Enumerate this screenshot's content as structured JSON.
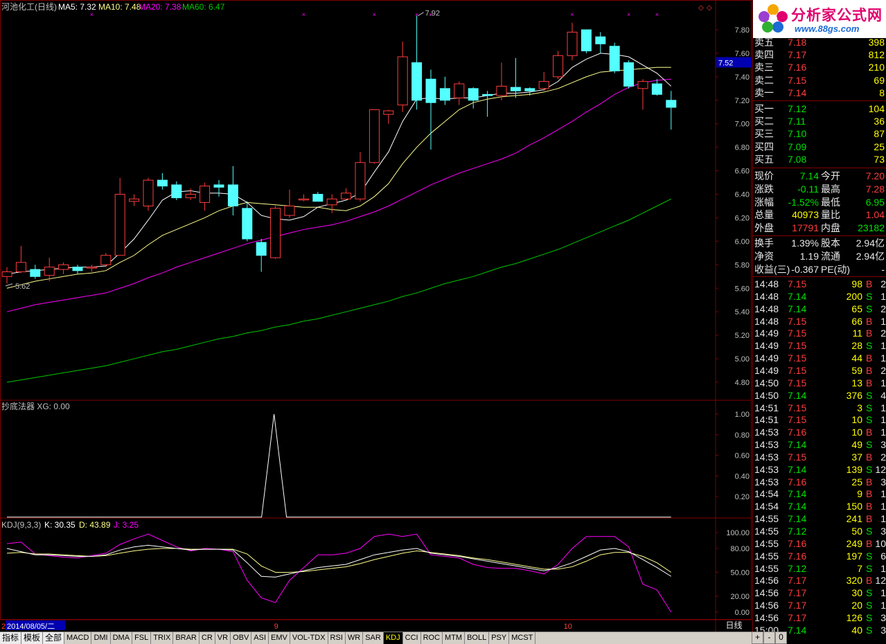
{
  "header": {
    "name": "河池化工(日线)",
    "ma5": "MA5: 7.32",
    "ma10": "MA10: 7.48",
    "ma20": "MA20: 7.38",
    "ma60": "MA60: 6.47",
    "high_label": "7.92",
    "low_label": "5.62",
    "current_price_tag": "7.52"
  },
  "price_axis": [
    "7.80",
    "7.60",
    "7.40",
    "7.20",
    "7.00",
    "6.80",
    "6.60",
    "6.40",
    "6.20",
    "6.00",
    "5.80",
    "5.60",
    "5.40",
    "5.20",
    "5.00",
    "4.80"
  ],
  "xg_pane": {
    "title": "抄底法器 XG: 0.00",
    "axis": [
      "1.00",
      "0.80",
      "0.60",
      "0.40",
      "0.20"
    ]
  },
  "kdj_pane": {
    "title_name": "KDJ(9,3,3)",
    "k": "K: 30.35",
    "d": "D: 43.89",
    "j": "J: 3.25",
    "axis": [
      "100.00",
      "80.00",
      "50.00",
      "20.00",
      "0.00"
    ]
  },
  "date_axis": {
    "left_mark": "2",
    "date_label": "2014/08/05/二",
    "month9": "9",
    "month10": "10",
    "period": "日线"
  },
  "colors": {
    "up": "#ff3c3c",
    "down": "#54ffff",
    "ma5": "#ffffff",
    "ma10": "#ffff8c",
    "ma20": "#ff00ff",
    "ma60": "#00c800",
    "border": "#800000"
  },
  "logo": {
    "title": "分析家公式网",
    "url": "www.88gs.com"
  },
  "asks": [
    {
      "label": "卖五",
      "price": "7.18",
      "vol": "398"
    },
    {
      "label": "卖四",
      "price": "7.17",
      "vol": "812"
    },
    {
      "label": "卖三",
      "price": "7.16",
      "vol": "210"
    },
    {
      "label": "卖二",
      "price": "7.15",
      "vol": "69"
    },
    {
      "label": "卖一",
      "price": "7.14",
      "vol": "8"
    }
  ],
  "bids": [
    {
      "label": "买一",
      "price": "7.12",
      "vol": "104"
    },
    {
      "label": "买二",
      "price": "7.11",
      "vol": "36"
    },
    {
      "label": "买三",
      "price": "7.10",
      "vol": "87"
    },
    {
      "label": "买四",
      "price": "7.09",
      "vol": "25"
    },
    {
      "label": "买五",
      "price": "7.08",
      "vol": "73"
    }
  ],
  "stats": [
    {
      "l1": "现价",
      "v1": "7.14",
      "c1": "grn",
      "l2": "今开",
      "v2": "7.20",
      "c2": "red"
    },
    {
      "l1": "涨跌",
      "v1": "-0.11",
      "c1": "grn",
      "l2": "最高",
      "v2": "7.28",
      "c2": "red"
    },
    {
      "l1": "涨幅",
      "v1": "-1.52%",
      "c1": "grn",
      "l2": "最低",
      "v2": "6.95",
      "c2": "grn"
    },
    {
      "l1": "总量",
      "v1": "40973",
      "c1": "yel",
      "l2": "量比",
      "v2": "1.04",
      "c2": "red"
    },
    {
      "l1": "外盘",
      "v1": "17791",
      "c1": "red",
      "l2": "内盘",
      "v2": "23182",
      "c2": "grn"
    }
  ],
  "stats2": [
    {
      "l1": "换手",
      "v1": "1.39%",
      "l2": "股本",
      "v2": "2.94亿"
    },
    {
      "l1": "净资",
      "v1": "1.19",
      "l2": "流通",
      "v2": "2.94亿"
    },
    {
      "l1": "收益(三)",
      "v1": "-0.367",
      "l2": "PE(动)",
      "v2": "-"
    }
  ],
  "ticks": [
    [
      "14:48",
      "7.15",
      "98",
      "B",
      "2"
    ],
    [
      "14:48",
      "7.14",
      "200",
      "S",
      "1"
    ],
    [
      "14:48",
      "7.14",
      "65",
      "S",
      "2"
    ],
    [
      "14:48",
      "7.15",
      "66",
      "B",
      "1"
    ],
    [
      "14:49",
      "7.15",
      "11",
      "B",
      "2"
    ],
    [
      "14:49",
      "7.15",
      "28",
      "S",
      "1"
    ],
    [
      "14:49",
      "7.15",
      "44",
      "B",
      "1"
    ],
    [
      "14:49",
      "7.15",
      "59",
      "B",
      "2"
    ],
    [
      "14:50",
      "7.15",
      "13",
      "B",
      "1"
    ],
    [
      "14:50",
      "7.14",
      "376",
      "S",
      "4"
    ],
    [
      "14:51",
      "7.15",
      "3",
      "S",
      "1"
    ],
    [
      "14:51",
      "7.15",
      "10",
      "S",
      "1"
    ],
    [
      "14:53",
      "7.16",
      "10",
      "B",
      "1"
    ],
    [
      "14:53",
      "7.14",
      "49",
      "S",
      "3"
    ],
    [
      "14:53",
      "7.15",
      "37",
      "B",
      "2"
    ],
    [
      "14:53",
      "7.14",
      "139",
      "S",
      "12"
    ],
    [
      "14:53",
      "7.16",
      "25",
      "B",
      "3"
    ],
    [
      "14:54",
      "7.14",
      "9",
      "B",
      "1"
    ],
    [
      "14:54",
      "7.14",
      "150",
      "B",
      "1"
    ],
    [
      "14:55",
      "7.14",
      "241",
      "B",
      "1"
    ],
    [
      "14:55",
      "7.12",
      "50",
      "S",
      "3"
    ],
    [
      "14:55",
      "7.16",
      "249",
      "B",
      "10"
    ],
    [
      "14:55",
      "7.16",
      "197",
      "S",
      "6"
    ],
    [
      "14:55",
      "7.12",
      "7",
      "S",
      "1"
    ],
    [
      "14:56",
      "7.17",
      "320",
      "B",
      "12"
    ],
    [
      "14:56",
      "7.17",
      "30",
      "S",
      "1"
    ],
    [
      "14:56",
      "7.17",
      "20",
      "S",
      "1"
    ],
    [
      "14:56",
      "7.17",
      "126",
      "S",
      "3"
    ],
    [
      "15:00",
      "7.14",
      "40",
      "S",
      "3"
    ]
  ],
  "tabs": [
    "指标",
    "模板",
    "全部",
    "MACD",
    "DMI",
    "DMA",
    "FSL",
    "TRIX",
    "BRAR",
    "CR",
    "VR",
    "OBV",
    "ASI",
    "EMV",
    "VOL-TDX",
    "RSI",
    "WR",
    "SAR",
    "KDJ",
    "CCI",
    "ROC",
    "MTM",
    "BOLL",
    "PSY",
    "MCST"
  ],
  "selected_tab": "KDJ",
  "nav": [
    "+",
    "-",
    "0"
  ],
  "chart_data": {
    "type": "candlestick",
    "candles": [
      [
        5.7,
        5.74,
        5.64,
        5.78
      ],
      [
        5.74,
        5.82,
        5.73,
        5.96
      ],
      [
        5.76,
        5.7,
        5.68,
        5.8
      ],
      [
        5.71,
        5.78,
        5.66,
        5.86
      ],
      [
        5.76,
        5.8,
        5.72,
        5.82
      ],
      [
        5.78,
        5.75,
        5.72,
        5.8
      ],
      [
        5.78,
        5.78,
        5.74,
        5.8
      ],
      [
        5.8,
        5.88,
        5.78,
        5.9
      ],
      [
        5.88,
        6.4,
        5.88,
        6.54
      ],
      [
        6.34,
        6.36,
        6.3,
        6.4
      ],
      [
        6.3,
        6.52,
        6.26,
        6.54
      ],
      [
        6.52,
        6.47,
        6.44,
        6.58
      ],
      [
        6.48,
        6.37,
        6.35,
        6.51
      ],
      [
        6.37,
        6.4,
        6.35,
        6.45
      ],
      [
        6.33,
        6.47,
        6.26,
        6.5
      ],
      [
        6.48,
        6.46,
        6.38,
        6.52
      ],
      [
        6.48,
        6.3,
        6.22,
        6.64
      ],
      [
        6.28,
        6.02,
        6.0,
        6.34
      ],
      [
        5.99,
        5.88,
        5.74,
        6.02
      ],
      [
        5.86,
        6.28,
        5.85,
        6.3
      ],
      [
        6.22,
        6.3,
        6.2,
        6.44
      ],
      [
        6.36,
        6.36,
        6.34,
        6.4
      ],
      [
        6.4,
        6.34,
        6.34,
        6.42
      ],
      [
        6.31,
        6.36,
        6.24,
        6.4
      ],
      [
        6.36,
        6.41,
        6.36,
        6.45
      ],
      [
        6.36,
        6.67,
        6.34,
        6.76
      ],
      [
        6.67,
        7.12,
        6.66,
        7.12
      ],
      [
        7.08,
        7.11,
        7.0,
        7.12
      ],
      [
        7.16,
        7.57,
        7.1,
        7.7
      ],
      [
        7.52,
        7.2,
        7.12,
        7.92
      ],
      [
        7.38,
        7.18,
        6.78,
        7.46
      ],
      [
        7.3,
        7.2,
        7.16,
        7.4
      ],
      [
        7.22,
        7.34,
        7.16,
        7.36
      ],
      [
        7.3,
        7.2,
        7.13,
        7.31
      ],
      [
        7.25,
        7.24,
        7.06,
        7.28
      ],
      [
        7.24,
        7.32,
        7.2,
        7.52
      ],
      [
        7.31,
        7.28,
        7.22,
        7.56
      ],
      [
        7.3,
        7.28,
        7.24,
        7.31
      ],
      [
        7.3,
        7.36,
        7.28,
        7.44
      ],
      [
        7.4,
        7.58,
        7.38,
        7.62
      ],
      [
        7.58,
        7.78,
        7.54,
        7.86
      ],
      [
        7.8,
        7.62,
        7.6,
        7.8
      ],
      [
        7.74,
        7.68,
        7.6,
        7.78
      ],
      [
        7.66,
        7.45,
        7.43,
        7.69
      ],
      [
        7.52,
        7.32,
        7.3,
        7.54
      ],
      [
        7.3,
        7.36,
        7.12,
        7.38
      ],
      [
        7.34,
        7.25,
        7.24,
        7.38
      ],
      [
        7.2,
        7.14,
        6.95,
        7.28
      ]
    ],
    "ma5": [
      5.72,
      5.74,
      5.75,
      5.76,
      5.77,
      5.78,
      5.78,
      5.79,
      5.9,
      6.02,
      6.18,
      6.35,
      6.42,
      6.43,
      6.41,
      6.41,
      6.4,
      6.33,
      6.22,
      6.19,
      6.18,
      6.21,
      6.29,
      6.32,
      6.35,
      6.41,
      6.59,
      6.76,
      7.02,
      7.21,
      7.22,
      7.21,
      7.22,
      7.22,
      7.24,
      7.26,
      7.26,
      7.27,
      7.29,
      7.36,
      7.48,
      7.55,
      7.6,
      7.59,
      7.57,
      7.5,
      7.43,
      7.32
    ],
    "ma10": [
      5.6,
      5.63,
      5.66,
      5.68,
      5.7,
      5.72,
      5.73,
      5.75,
      5.82,
      5.88,
      5.97,
      6.05,
      6.1,
      6.15,
      6.2,
      6.26,
      6.3,
      6.33,
      6.32,
      6.31,
      6.3,
      6.29,
      6.29,
      6.27,
      6.26,
      6.3,
      6.38,
      6.49,
      6.66,
      6.8,
      6.92,
      7.02,
      7.12,
      7.18,
      7.21,
      7.23,
      7.24,
      7.25,
      7.27,
      7.3,
      7.35,
      7.4,
      7.44,
      7.45,
      7.46,
      7.47,
      7.48,
      7.48
    ],
    "ma20": [
      5.4,
      5.43,
      5.46,
      5.48,
      5.5,
      5.52,
      5.54,
      5.56,
      5.6,
      5.64,
      5.69,
      5.73,
      5.78,
      5.82,
      5.86,
      5.9,
      5.94,
      5.98,
      6.01,
      6.04,
      6.07,
      6.1,
      6.12,
      6.14,
      6.17,
      6.21,
      6.25,
      6.3,
      6.36,
      6.42,
      6.48,
      6.53,
      6.58,
      6.62,
      6.66,
      6.7,
      6.75,
      6.82,
      6.88,
      6.95,
      7.02,
      7.1,
      7.17,
      7.25,
      7.31,
      7.35,
      7.37,
      7.38
    ],
    "ma60": [
      4.8,
      4.82,
      4.84,
      4.86,
      4.88,
      4.9,
      4.92,
      4.94,
      4.97,
      5.0,
      5.03,
      5.06,
      5.08,
      5.11,
      5.14,
      5.17,
      5.19,
      5.22,
      5.24,
      5.27,
      5.29,
      5.32,
      5.34,
      5.37,
      5.4,
      5.43,
      5.46,
      5.49,
      5.53,
      5.56,
      5.6,
      5.64,
      5.67,
      5.7,
      5.74,
      5.78,
      5.81,
      5.85,
      5.89,
      5.93,
      5.98,
      6.03,
      6.08,
      6.13,
      6.18,
      6.24,
      6.3,
      6.36
    ],
    "xg_signal_index": 19,
    "kdj_k": [
      80,
      76,
      72,
      72,
      71,
      70,
      70,
      72,
      78,
      82,
      84,
      82,
      80,
      78,
      79,
      79,
      78,
      62,
      45,
      44,
      48,
      52,
      56,
      58,
      60,
      66,
      72,
      75,
      78,
      80,
      74,
      72,
      70,
      67,
      64,
      61,
      58,
      55,
      52,
      56,
      62,
      70,
      78,
      80,
      76,
      66,
      56,
      45
    ],
    "kdj_d": [
      74,
      75,
      73,
      73,
      72,
      71,
      70,
      71,
      74,
      77,
      79,
      80,
      80,
      79,
      79,
      79,
      79,
      73,
      58,
      50,
      50,
      51,
      53,
      55,
      57,
      61,
      66,
      70,
      74,
      77,
      75,
      73,
      71,
      68,
      66,
      63,
      60,
      57,
      54,
      54,
      57,
      64,
      72,
      75,
      75,
      70,
      62,
      50
    ],
    "kdj_j": [
      86,
      88,
      73,
      71,
      69,
      68,
      71,
      74,
      85,
      92,
      98,
      90,
      82,
      77,
      80,
      79,
      76,
      40,
      18,
      12,
      40,
      56,
      72,
      72,
      74,
      80,
      95,
      98,
      95,
      98,
      72,
      70,
      68,
      60,
      56,
      55,
      55,
      52,
      48,
      60,
      80,
      95,
      95,
      95,
      82,
      35,
      28,
      0
    ]
  }
}
